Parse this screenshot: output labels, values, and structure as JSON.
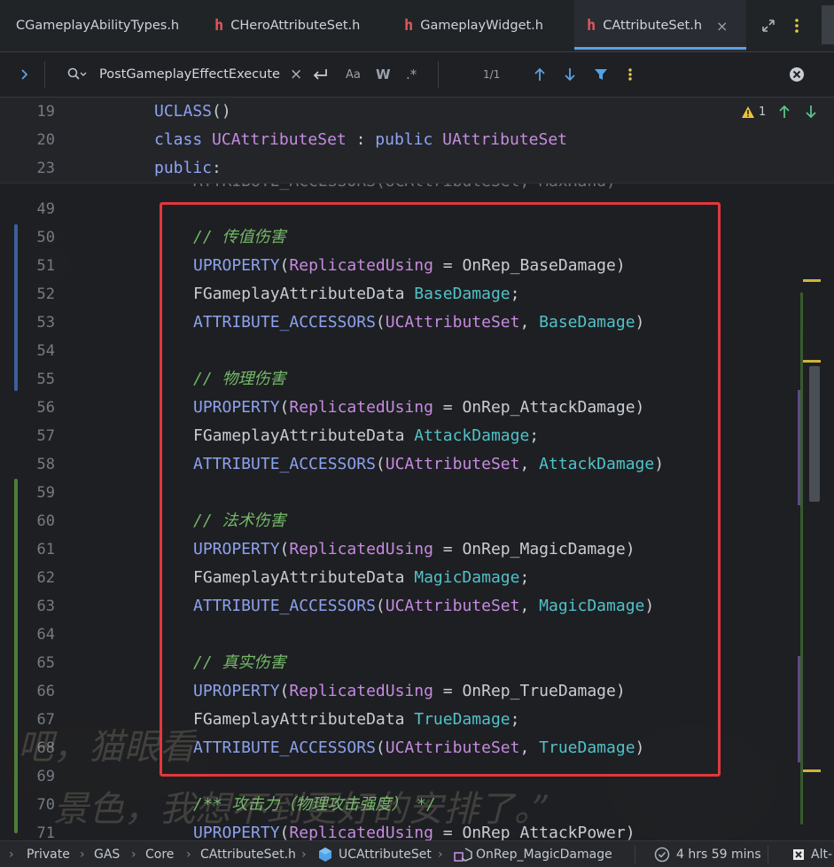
{
  "tabs": [
    {
      "label": "CGameplayAbilityTypes.h",
      "icon": false
    },
    {
      "label": "CHeroAttributeSet.h",
      "icon": true
    },
    {
      "label": "GameplayWidget.h",
      "icon": true
    },
    {
      "label": "CAttributeSet.h",
      "icon": true,
      "active": true
    }
  ],
  "tab_icon_glyph": "h",
  "tab_close": "×",
  "search": {
    "query": "PostGameplayEffectExecute",
    "match_count": "1/1",
    "case_label": "Aa",
    "word_label": "W",
    "regex_label": ".*"
  },
  "inspection": {
    "warning_count": "1"
  },
  "sticky_lines": [
    {
      "num": "19",
      "tokens": [
        {
          "t": "UCLASS",
          "c": "macro"
        },
        {
          "t": "()",
          "c": "plain"
        }
      ]
    },
    {
      "num": "20",
      "tokens": [
        {
          "t": "class ",
          "c": "kw"
        },
        {
          "t": "UCAttributeSet",
          "c": "param"
        },
        {
          "t": " : ",
          "c": "plain"
        },
        {
          "t": "public ",
          "c": "kw"
        },
        {
          "t": "UAttributeSet",
          "c": "param"
        }
      ]
    },
    {
      "num": "23",
      "tokens": [
        {
          "t": "public",
          "c": "kw"
        },
        {
          "t": ":",
          "c": "plain"
        }
      ]
    }
  ],
  "ghost_text": "ATTRIBUTE_ACCESSORS(UCAttributeSet, MaxHand)",
  "code_lines": [
    {
      "num": "49",
      "indent": 0,
      "tokens": []
    },
    {
      "num": "50",
      "indent": 1,
      "tokens": [
        {
          "t": "// 传值伤害",
          "c": "comment"
        }
      ]
    },
    {
      "num": "51",
      "indent": 1,
      "tokens": [
        {
          "t": "UPROPERTY",
          "c": "macro"
        },
        {
          "t": "(",
          "c": "plain"
        },
        {
          "t": "ReplicatedUsing",
          "c": "param"
        },
        {
          "t": " = OnRep_BaseDamage)",
          "c": "plain"
        }
      ]
    },
    {
      "num": "52",
      "indent": 1,
      "tokens": [
        {
          "t": "FGameplayAttributeData ",
          "c": "type"
        },
        {
          "t": "BaseDamage",
          "c": "field"
        },
        {
          "t": ";",
          "c": "plain"
        }
      ]
    },
    {
      "num": "53",
      "indent": 1,
      "tokens": [
        {
          "t": "ATTRIBUTE_ACCESSORS",
          "c": "macro"
        },
        {
          "t": "(",
          "c": "plain"
        },
        {
          "t": "UCAttributeSet",
          "c": "param"
        },
        {
          "t": ", ",
          "c": "plain"
        },
        {
          "t": "BaseDamage",
          "c": "field"
        },
        {
          "t": ")",
          "c": "plain"
        }
      ]
    },
    {
      "num": "54",
      "indent": 0,
      "tokens": []
    },
    {
      "num": "55",
      "indent": 1,
      "tokens": [
        {
          "t": "// 物理伤害",
          "c": "comment"
        }
      ]
    },
    {
      "num": "56",
      "indent": 1,
      "tokens": [
        {
          "t": "UPROPERTY",
          "c": "macro"
        },
        {
          "t": "(",
          "c": "plain"
        },
        {
          "t": "ReplicatedUsing",
          "c": "param"
        },
        {
          "t": " = OnRep_AttackDamage)",
          "c": "plain"
        }
      ]
    },
    {
      "num": "57",
      "indent": 1,
      "tokens": [
        {
          "t": "FGameplayAttributeData ",
          "c": "type"
        },
        {
          "t": "AttackDamage",
          "c": "field"
        },
        {
          "t": ";",
          "c": "plain"
        }
      ]
    },
    {
      "num": "58",
      "indent": 1,
      "tokens": [
        {
          "t": "ATTRIBUTE_ACCESSORS",
          "c": "macro"
        },
        {
          "t": "(",
          "c": "plain"
        },
        {
          "t": "UCAttributeSet",
          "c": "param"
        },
        {
          "t": ", ",
          "c": "plain"
        },
        {
          "t": "AttackDamage",
          "c": "field"
        },
        {
          "t": ")",
          "c": "plain"
        }
      ]
    },
    {
      "num": "59",
      "indent": 0,
      "tokens": []
    },
    {
      "num": "60",
      "indent": 1,
      "tokens": [
        {
          "t": "// 法术伤害",
          "c": "comment"
        }
      ]
    },
    {
      "num": "61",
      "indent": 1,
      "tokens": [
        {
          "t": "UPROPERTY",
          "c": "macro"
        },
        {
          "t": "(",
          "c": "plain"
        },
        {
          "t": "ReplicatedUsing",
          "c": "param"
        },
        {
          "t": " = OnRep_MagicDamage)",
          "c": "plain"
        }
      ]
    },
    {
      "num": "62",
      "indent": 1,
      "tokens": [
        {
          "t": "FGameplayAttributeData ",
          "c": "type"
        },
        {
          "t": "MagicDamage",
          "c": "field"
        },
        {
          "t": ";",
          "c": "plain"
        }
      ]
    },
    {
      "num": "63",
      "indent": 1,
      "tokens": [
        {
          "t": "ATTRIBUTE_ACCESSORS",
          "c": "macro"
        },
        {
          "t": "(",
          "c": "plain"
        },
        {
          "t": "UCAttributeSet",
          "c": "param"
        },
        {
          "t": ", ",
          "c": "plain"
        },
        {
          "t": "MagicDamage",
          "c": "field"
        },
        {
          "t": ")",
          "c": "plain"
        }
      ]
    },
    {
      "num": "64",
      "indent": 0,
      "tokens": []
    },
    {
      "num": "65",
      "indent": 1,
      "tokens": [
        {
          "t": "// 真实伤害",
          "c": "comment"
        }
      ]
    },
    {
      "num": "66",
      "indent": 1,
      "tokens": [
        {
          "t": "UPROPERTY",
          "c": "macro"
        },
        {
          "t": "(",
          "c": "plain"
        },
        {
          "t": "ReplicatedUsing",
          "c": "param"
        },
        {
          "t": " = OnRep_TrueDamage)",
          "c": "plain"
        }
      ]
    },
    {
      "num": "67",
      "indent": 1,
      "tokens": [
        {
          "t": "FGameplayAttributeData ",
          "c": "type"
        },
        {
          "t": "TrueDamage",
          "c": "field"
        },
        {
          "t": ";",
          "c": "plain"
        }
      ]
    },
    {
      "num": "68",
      "indent": 1,
      "tokens": [
        {
          "t": "ATTRIBUTE_ACCESSORS",
          "c": "macro"
        },
        {
          "t": "(",
          "c": "plain"
        },
        {
          "t": "UCAttributeSet",
          "c": "param"
        },
        {
          "t": ", ",
          "c": "plain"
        },
        {
          "t": "TrueDamage",
          "c": "field"
        },
        {
          "t": ")",
          "c": "plain"
        }
      ]
    },
    {
      "num": "69",
      "indent": 0,
      "tokens": []
    },
    {
      "num": "70",
      "indent": 1,
      "tokens": [
        {
          "t": "/** 攻击力（物理攻击强度） */",
          "c": "doc"
        }
      ]
    },
    {
      "num": "71",
      "indent": 1,
      "tokens": [
        {
          "t": "UPROPERTY",
          "c": "macro"
        },
        {
          "t": "(",
          "c": "plain"
        },
        {
          "t": "ReplicatedUsing",
          "c": "param"
        },
        {
          "t": " = OnRep_AttackPower)",
          "c": "plain"
        }
      ]
    }
  ],
  "breadcrumb": [
    "Private",
    "GAS",
    "Core",
    "CAttributeSet.h",
    "UCAttributeSet",
    "OnRep_MagicDamage"
  ],
  "status": {
    "time": "4 hrs 59 mins",
    "alt_hint": "Alt-"
  },
  "wallpaper_text": [
    "吧，猫眼看",
    "景色，我想不到更好的安排了。”"
  ],
  "colors": {
    "accent": "#5aa3e6",
    "highlight_box": "#e2383d",
    "warning": "#f0c23b",
    "filter": "#4fa3e8"
  }
}
